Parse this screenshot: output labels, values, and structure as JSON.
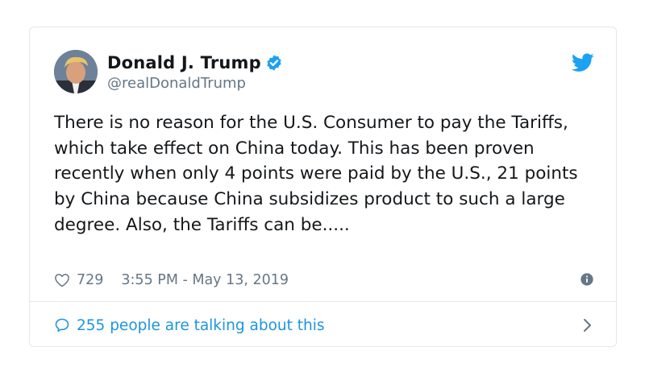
{
  "author": {
    "display_name": "Donald J. Trump",
    "handle": "@realDonaldTrump",
    "verified": true
  },
  "tweet": {
    "text": "There is no reason for the U.S. Consumer to pay the Tariffs, which take effect on China today. This has been proven recently when only 4 points were paid by the U.S., 21 points by China because China subsidizes product to such a large degree. Also, the Tariffs can be.....",
    "likes": "729",
    "timestamp": "3:55 PM - May 13, 2019"
  },
  "footer": {
    "talking_label": "255 people are talking about this"
  },
  "colors": {
    "accent": "#1b95e0",
    "verified": "#1da1f2",
    "muted": "#657786",
    "border": "#e1e8ed",
    "text": "#14171a"
  },
  "icons": {
    "brand": "twitter-bird-icon",
    "verified": "verified-badge-icon",
    "like": "heart-outline-icon",
    "info": "info-circle-icon",
    "reply": "speech-bubble-icon",
    "chevron": "chevron-right-icon"
  }
}
